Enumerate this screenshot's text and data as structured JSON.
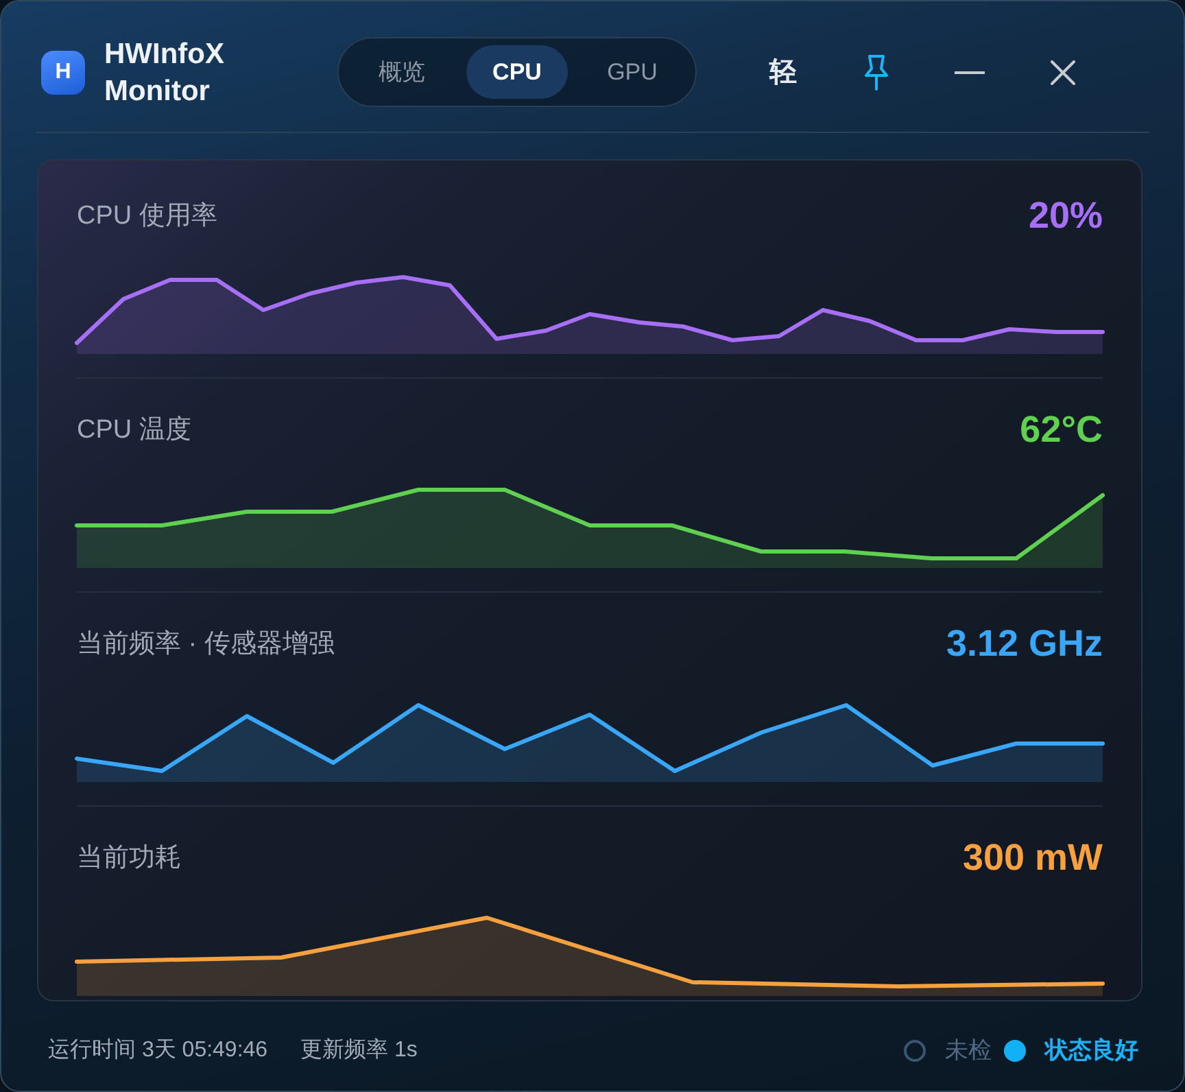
{
  "window": {
    "title": "HWInfoX Monitor",
    "logo": "H"
  },
  "tabs": [
    {
      "label": "概览",
      "selected": false
    },
    {
      "label": "CPU",
      "selected": true
    },
    {
      "label": "GPU",
      "selected": false
    }
  ],
  "controls": [
    {
      "kind": "text",
      "label": "轻"
    },
    {
      "kind": "pin",
      "on": true
    },
    {
      "kind": "minimize"
    },
    {
      "kind": "close"
    }
  ],
  "metrics": [
    {
      "label": "CPU 使用率",
      "value": "20%",
      "color": "#a66ff5"
    },
    {
      "label": "CPU 温度",
      "value": "62°C",
      "color": "#5fd04f"
    },
    {
      "label": "当前频率 · 传感器增强",
      "value": "3.12 GHz",
      "color": "#3aa6f7"
    },
    {
      "label": "当前功耗",
      "value": "300 mW",
      "color": "#f7a040"
    }
  ],
  "status_bar": {
    "items": [
      {
        "text": "运行时间 3天 05:49:46"
      },
      {
        "text": "更新频率 1s"
      }
    ],
    "indicators": [
      {
        "label": "未检",
        "active": false
      },
      {
        "label": "状态良好",
        "active": true
      }
    ]
  }
}
